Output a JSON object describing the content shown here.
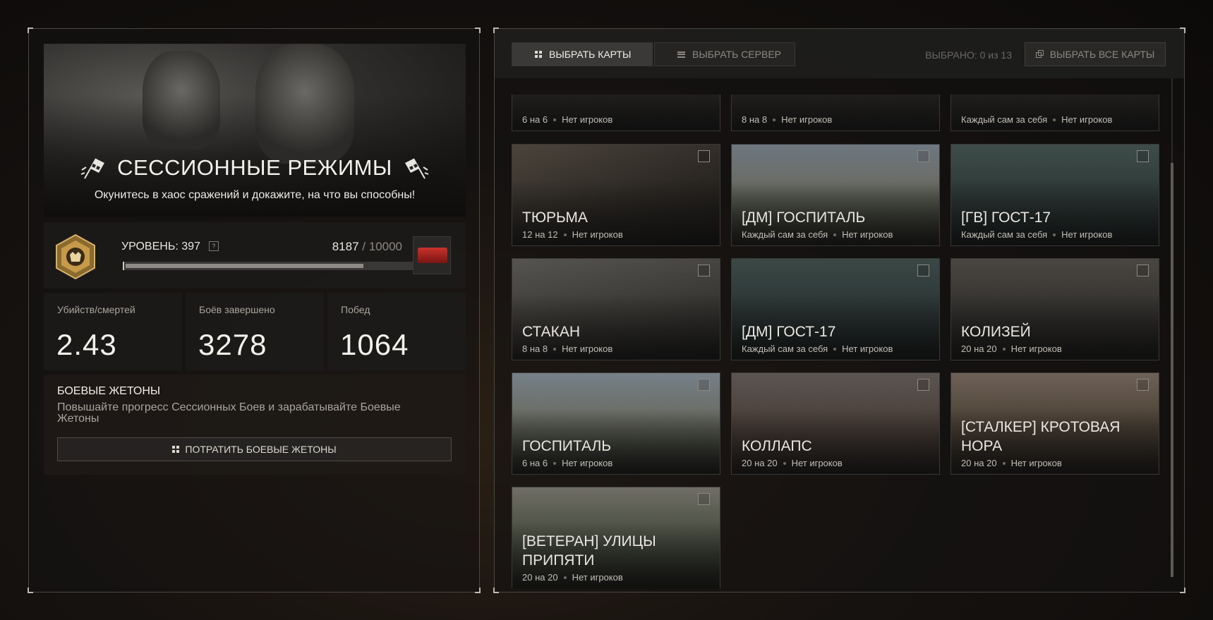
{
  "left": {
    "title": "СЕССИОННЫЕ РЕЖИМЫ",
    "subtitle": "Окунитесь в хаос сражений и докажите, на что вы способны!",
    "level_label": "УРОВЕНЬ: 397",
    "help_glyph": "?",
    "xp_current": "8187",
    "xp_max": " / 10000",
    "xp_progress": 0.8187,
    "stats": [
      {
        "label": "Убийств/смертей",
        "value": "2.43"
      },
      {
        "label": "Боёв завершено",
        "value": "3278"
      },
      {
        "label": "Побед",
        "value": "1064"
      }
    ],
    "tokens": {
      "title": "БОЕВЫЕ ЖЕТОНЫ",
      "description": "Повышайте прогресс Сессионных Боев и зарабатывайте Боевые Жетоны",
      "button_label": "ПОТРАТИТЬ БОЕВЫЕ ЖЕТОНЫ"
    }
  },
  "right": {
    "tab_maps": "ВЫБРАТЬ КАРТЫ",
    "tab_server": "ВЫБРАТЬ СЕРВЕР",
    "selected_count": "ВЫБРАНО: 0 из 13",
    "select_all": "ВЫБРАТЬ ВСЕ КАРТЫ",
    "top_row": [
      {
        "name": "",
        "mode": "6 на 6",
        "players": "Нет игроков"
      },
      {
        "name": "",
        "mode": "8 на 8",
        "players": "Нет игроков"
      },
      {
        "name": "",
        "mode": "Каждый сам за себя",
        "players": "Нет игроков"
      }
    ],
    "maps": [
      {
        "name": "ТЮРЬМА",
        "mode": "12 на 12",
        "players": "Нет игроков"
      },
      {
        "name": "[ДМ] ГОСПИТАЛЬ",
        "mode": "Каждый сам за себя",
        "players": "Нет игроков"
      },
      {
        "name": "[ГВ] ГОСТ-17",
        "mode": "Каждый сам за себя",
        "players": "Нет игроков"
      },
      {
        "name": "СТАКАН",
        "mode": "8 на 8",
        "players": "Нет игроков"
      },
      {
        "name": "[ДМ] ГОСТ-17",
        "mode": "Каждый сам за себя",
        "players": "Нет игроков"
      },
      {
        "name": "КОЛИЗЕЙ",
        "mode": "20 на 20",
        "players": "Нет игроков"
      },
      {
        "name": "ГОСПИТАЛЬ",
        "mode": "6 на 6",
        "players": "Нет игроков"
      },
      {
        "name": "КОЛЛАПС",
        "mode": "20 на 20",
        "players": "Нет игроков"
      },
      {
        "name": "[СТАЛКЕР] КРОТОВАЯ НОРА",
        "mode": "20 на 20",
        "players": "Нет игроков"
      },
      {
        "name": "[ВЕТЕРАН] УЛИЦЫ ПРИПЯТИ",
        "mode": "20 на 20",
        "players": "Нет игроков"
      }
    ]
  }
}
